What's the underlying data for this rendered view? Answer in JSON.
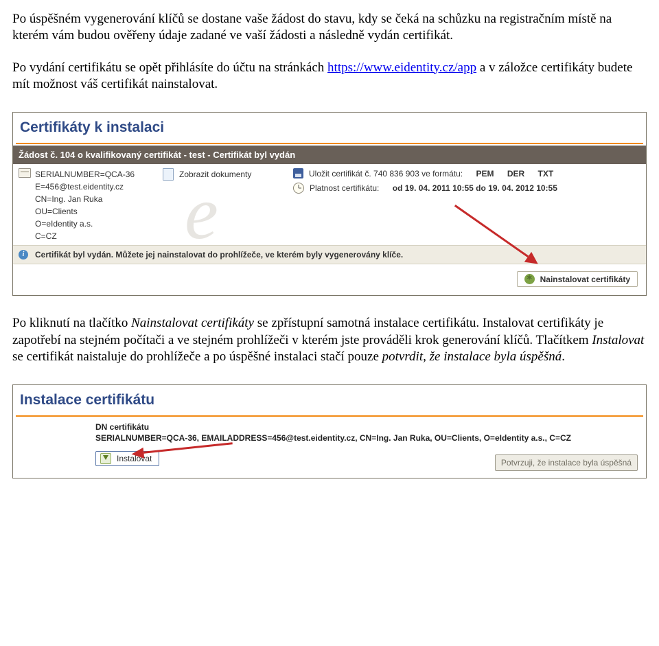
{
  "para1": "Po úspěšném vygenerování klíčů se dostane vaše žádost do stavu, kdy se čeká na schůzku na registračním místě na kterém vám budou ověřeny údaje zadané ve vaší žádosti a následně vydán certifikát.",
  "para2": {
    "prefix": "Po vydání certifikátu se opět přihlásíte do účtu na stránkách  ",
    "link": "https://www.eidentity.cz/app",
    "suffix": " a v záložce certifikáty budete mít možnost váš certifikát nainstalovat."
  },
  "panel1": {
    "heading": "Certifikáty k instalaci",
    "request_bar": "Žádost č. 104 o kvalifikovaný certifikát - test - Certifikát byl vydán",
    "serial": {
      "l1": "SERIALNUMBER=QCA-36",
      "l2": "E=456@test.eidentity.cz",
      "l3": "CN=Ing. Jan Ruka",
      "l4": "OU=Clients",
      "l5": "O=eIdentity a.s.",
      "l6": "C=CZ"
    },
    "zobrazit": "Zobrazit dokumenty",
    "save_label": "Uložit certifikát č. 740 836 903 ve formátu:",
    "fmt1": "PEM",
    "fmt2": "DER",
    "fmt3": "TXT",
    "validity_label": "Platnost certifikátu:",
    "validity_value": "od 19. 04. 2011 10:55 do 19. 04. 2012 10:55",
    "issued_msg": "Certifikát byl vydán. Můžete jej nainstalovat do prohlížeče, ve kterém byly vygenerovány klíče.",
    "install_btn": "Nainstalovat certifikáty"
  },
  "para3": {
    "prefix": "Po kliknutí na tlačítko ",
    "em1": "Nainstalovat certifikáty",
    "mid1": " se zpřístupní samotná instalace certifikátu. Instalovat certifikáty je zapotřebí na stejném počítači a ve stejném prohlížeči v kterém jste prováděli krok generování klíčů. Tlačítkem ",
    "em2": "Instalovat",
    "mid2": " se certifikát naistaluje do prohlížeče a po úspěšné instalaci stačí pouze ",
    "em3": "potvrdit, že instalace byla úspěšná",
    "suffix": "."
  },
  "panel2": {
    "heading": "Instalace certifikátu",
    "dn_label": "DN certifikátu",
    "dn_value": "SERIALNUMBER=QCA-36, EMAILADDRESS=456@test.eidentity.cz, CN=Ing. Jan Ruka, OU=Clients, O=eIdentity a.s., C=CZ",
    "install_label": "Instalovat",
    "confirm_label": "Potvrzuji, že instalace byla úspěšná"
  }
}
